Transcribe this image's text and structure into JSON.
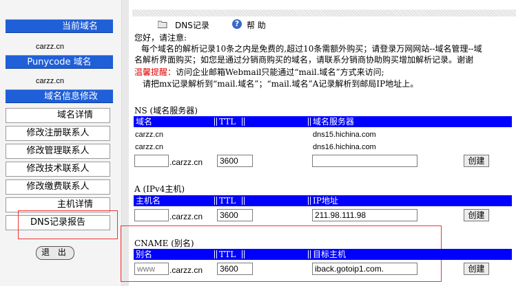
{
  "sidebar": {
    "current_domain_label": "当前域名",
    "current_domain_value": "carzz.cn",
    "punycode_label": "Punycode 域名",
    "punycode_value": "carzz.cn",
    "modify_info_label": "域名信息修改",
    "buttons": [
      "域名详情",
      "修改注册联系人",
      "修改管理联系人",
      "修改技术联系人",
      "修改缴费联系人",
      "主机详情",
      "DNS记录报告"
    ],
    "logout_label": "退 出"
  },
  "toolbar": {
    "dns_label": "DNS记录",
    "help_label": "帮 助"
  },
  "notice": {
    "greeting": "您好，请注意:",
    "line1": "每个域名的解析记录10条之内是免费的,超过10条需额外购买；请登录万网网站--域名管理--域",
    "line2": "名解析界面购买；如您是通过分销商购买的域名，请联系分销商协助购买增加解析记录。谢谢",
    "warn_label": "温馨提醒：",
    "warn_text": "访问企业邮箱Webmail只能通过“mail.域名”方式来访问;",
    "line4": "请把mx记录解析到“mail.域名”；“mail.域名”A记录解析到邮局IP地址上。"
  },
  "ns": {
    "title": "NS (域名服务器)",
    "headers": [
      "域名",
      "TTL",
      "域名服务器"
    ],
    "rows": [
      {
        "domain": "carzz.cn",
        "server": "dns15.hichina.com"
      },
      {
        "domain": "carzz.cn",
        "server": "dns16.hichina.com"
      }
    ],
    "input_name": "",
    "suffix": ".carzz.cn",
    "ttl": "3600",
    "server_value": "",
    "create_label": "创建"
  },
  "a": {
    "title": "A (IPv4主机)",
    "headers": [
      "主机名",
      "TTL",
      "IP地址"
    ],
    "input_name": "",
    "suffix": ".carzz.cn",
    "ttl": "3600",
    "ip_value": "211.98.111.98",
    "create_label": "创建"
  },
  "cname": {
    "title": "CNAME (别名)",
    "headers": [
      "别名",
      "TTL",
      "目标主机"
    ],
    "input_name": "www",
    "suffix": ".carzz.cn",
    "ttl": "3600",
    "target_value": "iback.gotoip1.com.",
    "create_label": "创建"
  },
  "colors": {
    "header_blue": "#0000ff",
    "side_blue": "#1f5fd8",
    "highlight_red": "#e33333"
  }
}
